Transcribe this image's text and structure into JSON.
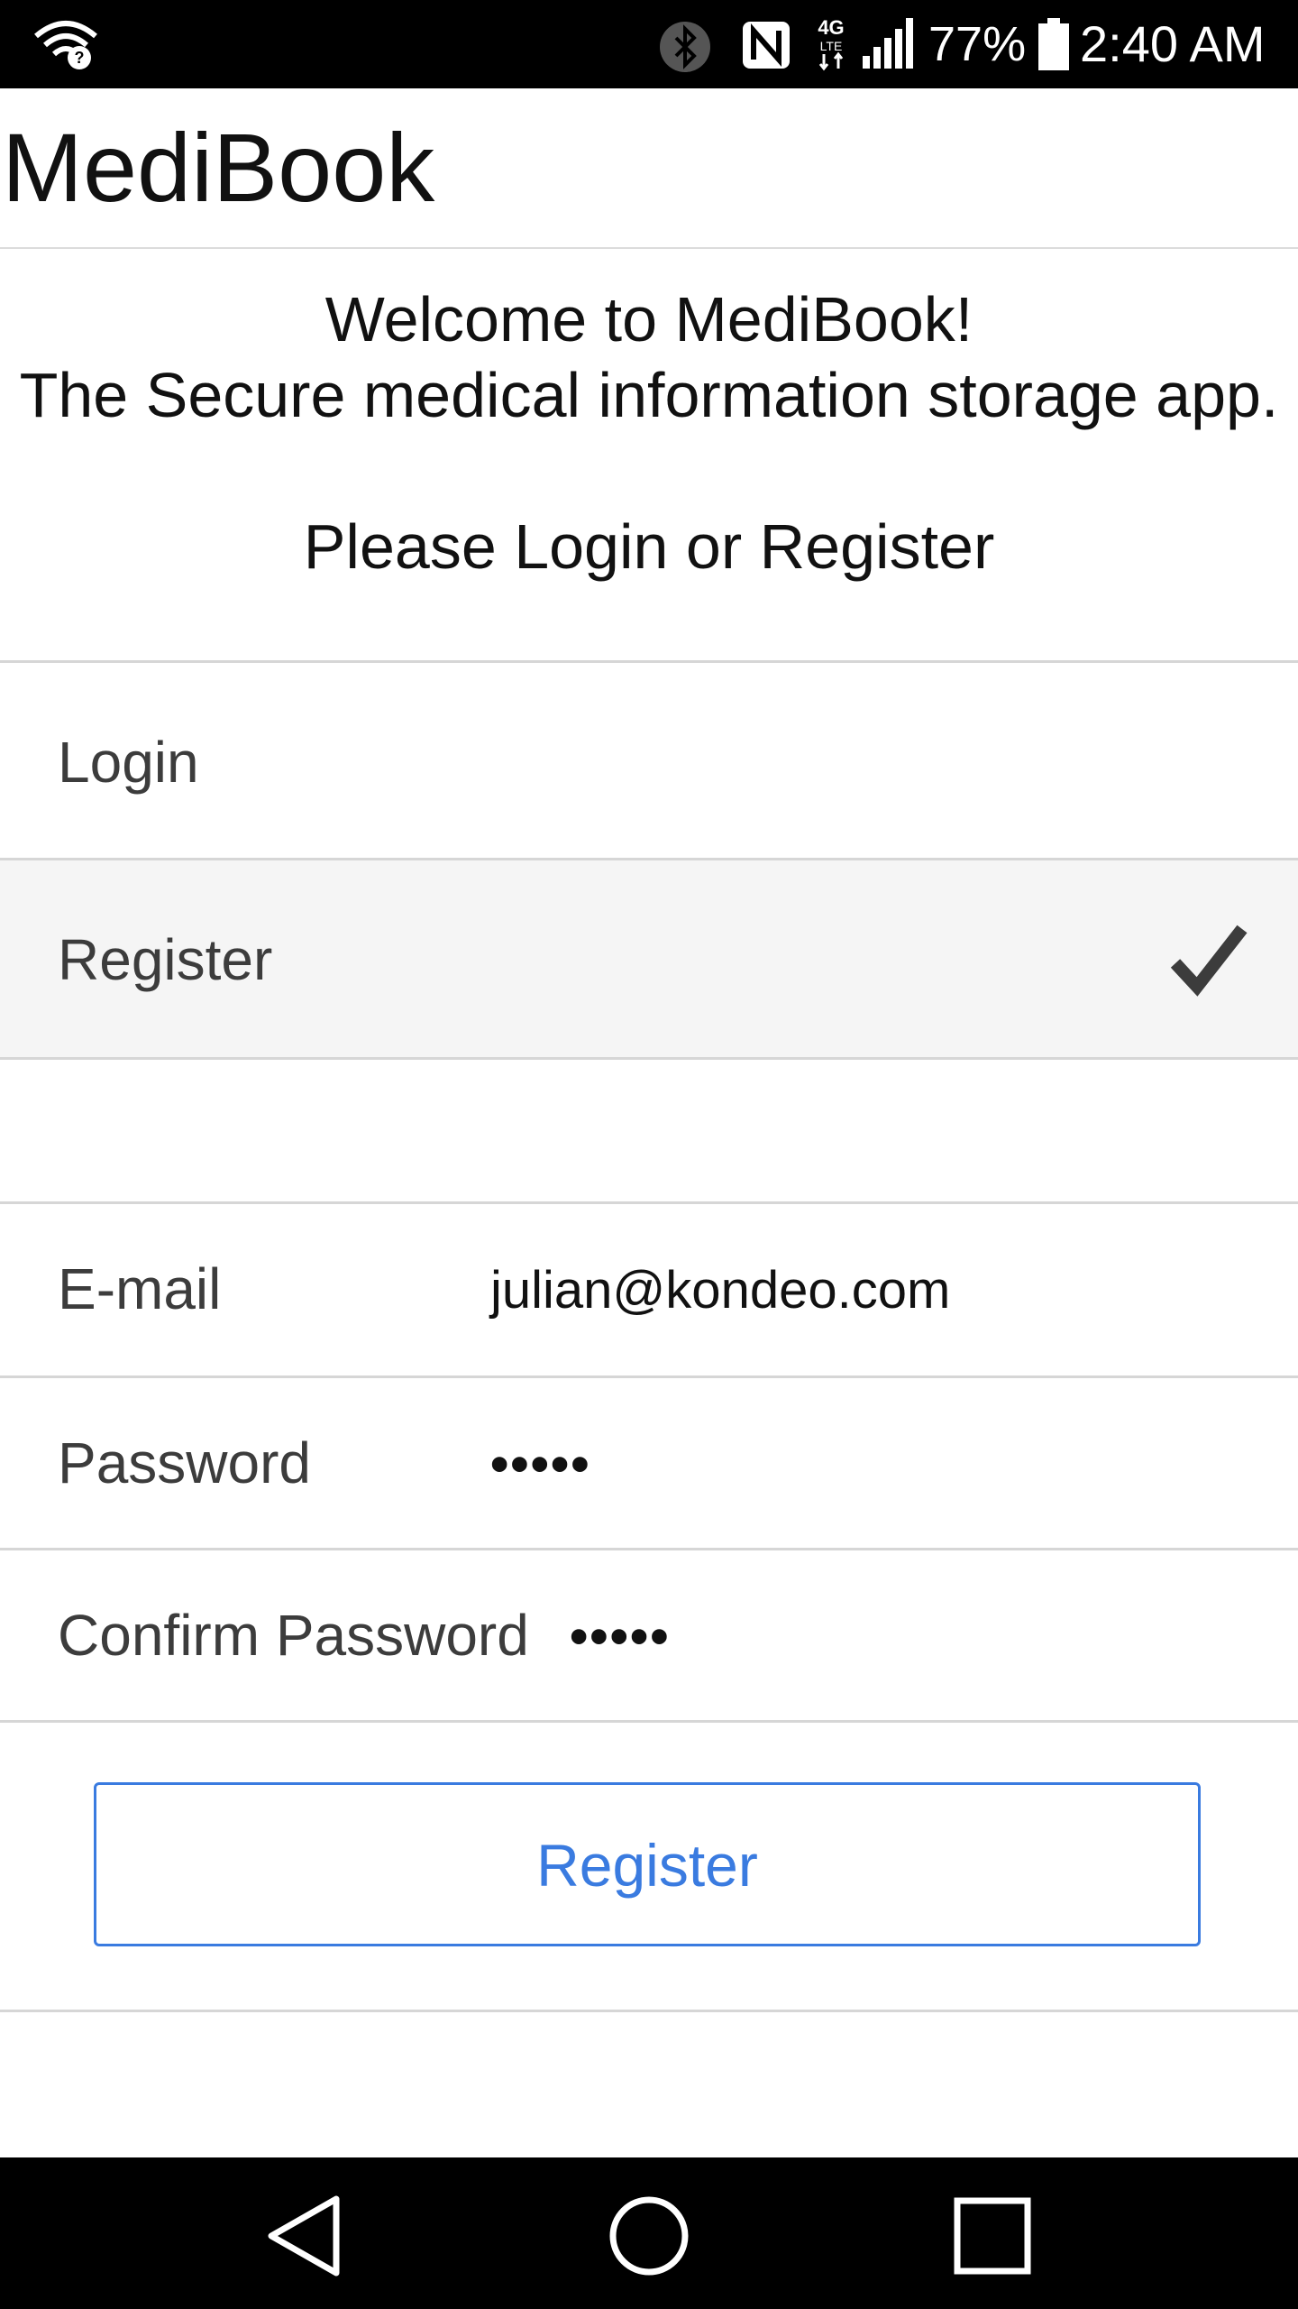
{
  "status_bar": {
    "battery_percent": "77%",
    "time": "2:40 AM",
    "icons": [
      "wifi-question-icon",
      "bluetooth-icon",
      "nfc-icon",
      "4g-lte-icon",
      "cell-signal-icon",
      "battery-icon"
    ]
  },
  "app": {
    "title": "MediBook"
  },
  "intro": {
    "welcome": "Welcome to MediBook!",
    "tagline": "The Secure medical information storage app.",
    "prompt": "Please Login or Register"
  },
  "mode_options": [
    {
      "label": "Login",
      "selected": false
    },
    {
      "label": "Register",
      "selected": true
    }
  ],
  "form": {
    "email": {
      "label": "E-mail",
      "value": "julian@kondeo.com"
    },
    "password": {
      "label": "Password",
      "value": "•••••"
    },
    "confirm_password": {
      "label": "Confirm Password",
      "value": "•••••"
    }
  },
  "register_button_label": "Register",
  "colors": {
    "accent": "#3a7be0",
    "selected_row_bg": "#f5f5f5",
    "divider": "#d6d6d6"
  },
  "nav_bar": {
    "icons": [
      "back-icon",
      "home-icon",
      "recents-icon"
    ]
  }
}
